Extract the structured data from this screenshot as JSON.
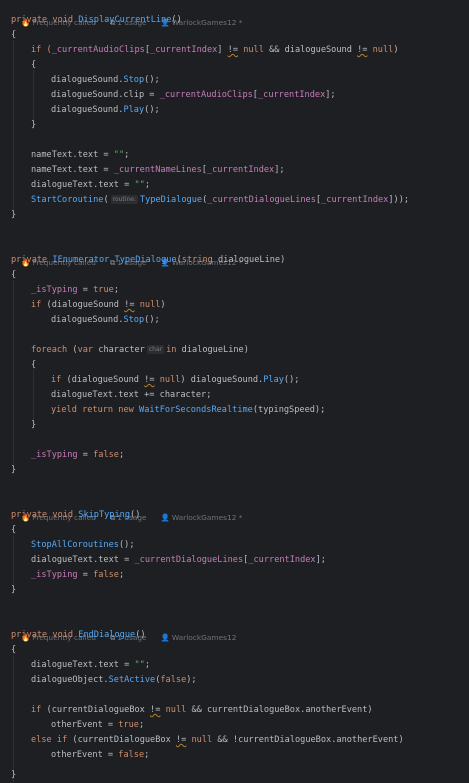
{
  "hints": {
    "frequently_called": "Frequently called",
    "usage": "1 usage",
    "author_mod": "WarlockGames12 *",
    "author": "WarlockGames12"
  },
  "code": {
    "m1_sig_a": "private void ",
    "m1_name": "DisplayCurrentLine",
    "m1_sig_b": "()",
    "brace_open": "{",
    "brace_close": "}",
    "l_if_audio_a": "if (",
    "l_if_audio_b": "_currentAudioClips",
    "l_if_audio_c": "[",
    "l_if_audio_d": "_currentIndex",
    "l_if_audio_e": "] ",
    "neq": "!=",
    "null_kw": "null",
    "and_op": " && ",
    "dialogueSound": "dialogueSound",
    "l_stop_a": "dialogueSound.",
    "stop_call": "Stop",
    "paren_semi": "();",
    "l_clip_a": "dialogueSound.clip = ",
    "l_clip_b": "_currentAudioClips",
    "l_clip_c": "[",
    "l_clip_d": "_currentIndex",
    "l_clip_e": "];",
    "play_call": "Play",
    "l_name_empty": "nameText.text = ",
    "empty_str": "\"\"",
    "semi": ";",
    "l_name_set": "nameText.text = ",
    "l_name_set_b": "_currentNameLines",
    "l_dialog_empty": "dialogueText.text = ",
    "start_coroutine": "StartCoroutine",
    "routine_hint": "routine:",
    "type_dialogue": "TypeDialogue",
    "l_sc_b": "_currentDialogueLines",
    "l_sc_end": "]));",
    "m2_sig_a": "private ",
    "m2_type": "IEnumerator",
    "m2_sig_b": " (",
    "m2_param_type": "string",
    "m2_param": " dialogueLine)",
    "is_typing": "_isTyping",
    "assign": " = ",
    "true_kw": "true",
    "false_kw": "false",
    "if_kw": "if",
    "foreach_kw": "foreach",
    "var_kw": "var",
    "in_kw": "in",
    "char_hint": "char",
    "character": " character",
    "dialogue_line": " dialogueLine)",
    "l_text_add": "dialogueText.text += character;",
    "yield_kw": "yield",
    "return_kw": "return",
    "new_kw": "new",
    "wait_cls": "WaitForSecondsRealtime",
    "typing_speed": "(typingSpeed);",
    "m3_name": "SkipTyping",
    "stop_all": "StopAllCoroutines",
    "l_dt_set": "dialogueText.text = ",
    "m4_name": "EndDialogue",
    "dialogue_object": "dialogueObject.",
    "set_active": "SetActive",
    "current_box": "currentDialogueBox",
    "another_event": ".anotherEvent",
    "other_event": "otherEvent",
    "else_kw": "else"
  }
}
